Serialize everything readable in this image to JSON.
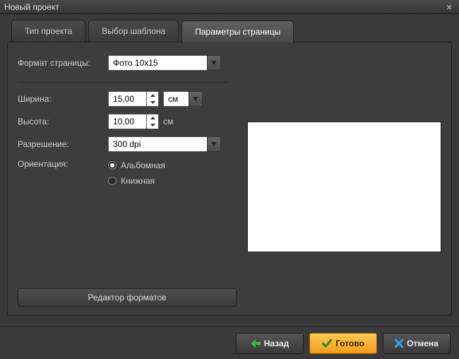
{
  "window": {
    "title": "Новый проект"
  },
  "tabs": {
    "project_type": "Тип проекта",
    "template": "Выбор шаблона",
    "page_params": "Параметры страницы"
  },
  "form": {
    "format_label": "Формат страницы:",
    "format_value": "Фото 10х15",
    "width_label": "Ширина:",
    "width_value": "15,00",
    "width_unit": "см",
    "height_label": "Высота:",
    "height_value": "10,00",
    "height_unit": "см",
    "resolution_label": "Разрешение:",
    "resolution_value": "300 dpi",
    "orientation_label": "Ориентация:",
    "orientation_landscape": "Альбомная",
    "orientation_portrait": "Книжная",
    "editor_button": "Редактор форматов"
  },
  "footer": {
    "back": "Назад",
    "finish": "Готово",
    "cancel": "Отмена"
  }
}
